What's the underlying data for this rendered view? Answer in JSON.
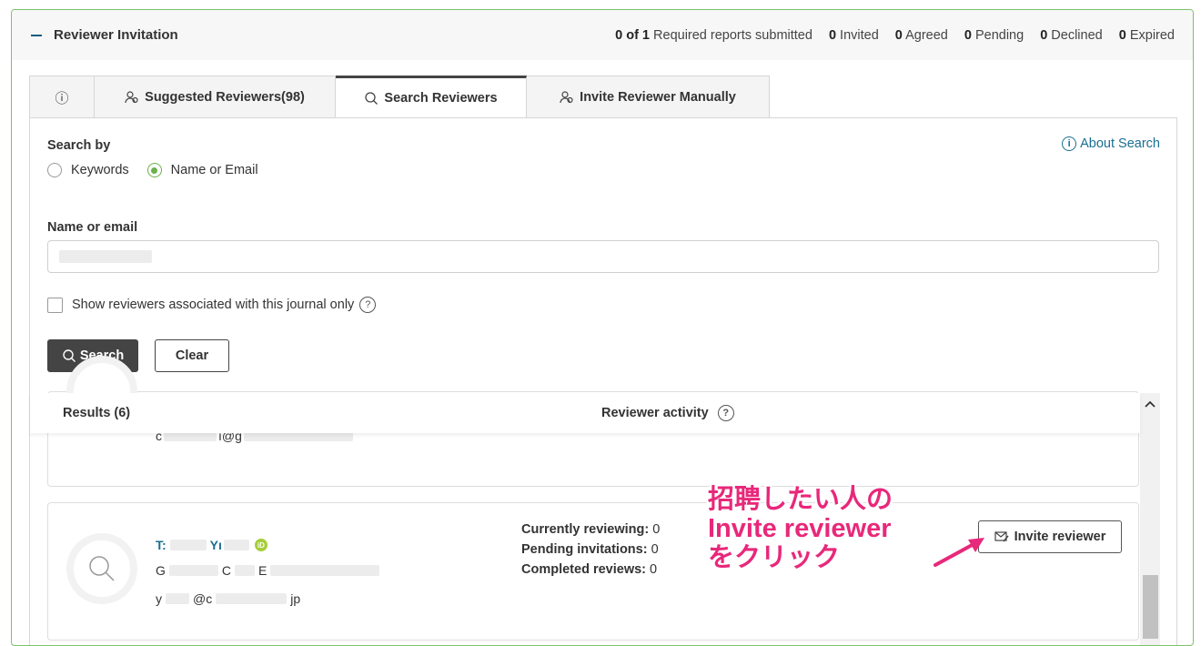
{
  "header": {
    "title": "Reviewer Invitation",
    "stats": [
      {
        "num": "0 of 1",
        "label": "Required reports submitted"
      },
      {
        "num": "0",
        "label": "Invited"
      },
      {
        "num": "0",
        "label": "Agreed"
      },
      {
        "num": "0",
        "label": "Pending"
      },
      {
        "num": "0",
        "label": "Declined"
      },
      {
        "num": "0",
        "label": "Expired"
      }
    ]
  },
  "tabs": {
    "info": "ⓘ",
    "suggested": "Suggested Reviewers(98)",
    "search": "Search Reviewers",
    "manual": "Invite Reviewer Manually"
  },
  "search_form": {
    "search_by_label": "Search by",
    "about_search": "About Search",
    "radio_keywords": "Keywords",
    "radio_name_email": "Name or Email",
    "name_label": "Name or email",
    "assoc_label": "Show reviewers associated with this journal only",
    "search_button": "Search",
    "clear_button": "Clear"
  },
  "results": {
    "title": "Results (6)",
    "activity_title": "Reviewer activity",
    "prev_email_partial_a": "c",
    "prev_email_partial_b": "ı@g",
    "reviewer": {
      "name_a": "T:",
      "name_b": "Yı",
      "affil_a": "G",
      "affil_b": "C",
      "affil_c": "E",
      "email_a": "y",
      "email_b": "@c",
      "email_c": "jp",
      "currently_reviewing_label": "Currently reviewing:",
      "currently_reviewing": "0",
      "pending_label": "Pending invitations:",
      "pending": "0",
      "completed_label": "Completed reviews:",
      "completed": "0"
    },
    "invite_button": "Invite reviewer"
  },
  "annotation": {
    "line1": "招聘したい人の",
    "line2": "Invite reviewer",
    "line3": "をクリック",
    "color": "#e8287a"
  }
}
